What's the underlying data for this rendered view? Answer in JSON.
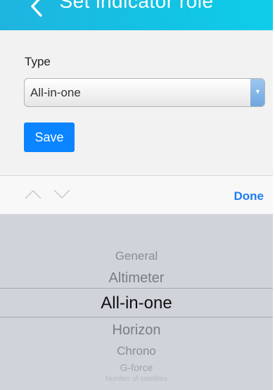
{
  "header": {
    "title": "Set indicator role",
    "back_icon": "chevron-left-icon"
  },
  "form": {
    "type_label": "Type",
    "select_value": "All-in-one",
    "save_label": "Save"
  },
  "toolbar": {
    "prev_icon": "chevron-up-icon",
    "next_icon": "chevron-down-icon",
    "done_label": "Done"
  },
  "picker": {
    "options": [
      "General",
      "Altimeter",
      "All-in-one",
      "Horizon",
      "Chrono",
      "G-force",
      "Number of satellites"
    ],
    "selected": "All-in-one"
  },
  "colors": {
    "header": "#13c3e4",
    "primary": "#0a84ff",
    "link": "#1e7ef2",
    "picker_bg": "#d0d4da"
  }
}
